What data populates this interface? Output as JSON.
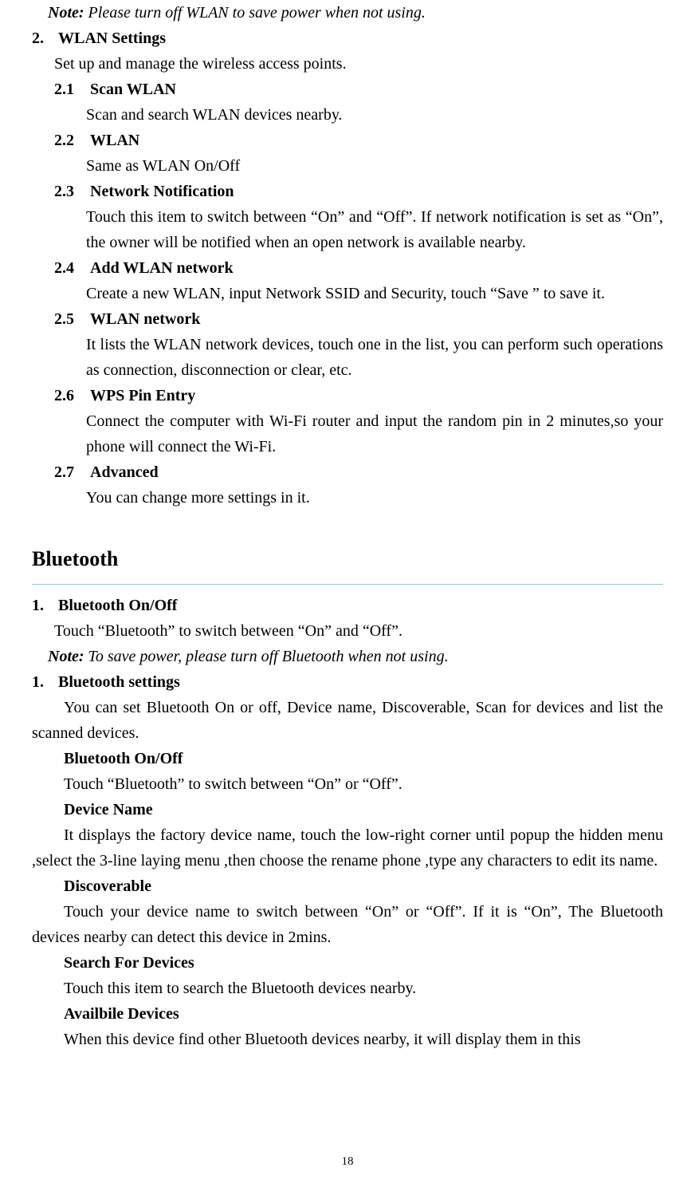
{
  "wlan": {
    "note": {
      "label": "Note:",
      "text": "Please turn off WLAN to save power when not using."
    },
    "item2": {
      "num": "2.",
      "title": "WLAN Settings",
      "body": "Set up and manage the wireless access points.",
      "sub": {
        "s21": {
          "num": "2.1",
          "title": "Scan WLAN",
          "body": "Scan and search WLAN devices nearby."
        },
        "s22": {
          "num": "2.2",
          "title": "WLAN",
          "body": "Same as WLAN On/Off"
        },
        "s23": {
          "num": "2.3",
          "title": "Network Notification",
          "body": "Touch this item to switch between “On” and “Off”. If network notification is set as “On”, the owner will be notified when an open network is available nearby."
        },
        "s24": {
          "num": "2.4",
          "title": "Add WLAN network",
          "body": "Create a new WLAN, input Network SSID and Security, touch “Save ” to save it."
        },
        "s25": {
          "num": "2.5",
          "title": "WLAN network",
          "body": "It lists the WLAN network devices, touch one in the list, you can perform such operations as connection, disconnection or clear, etc."
        },
        "s26": {
          "num": "2.6",
          "title": " WPS Pin Entry",
          "body": "Connect the computer with Wi-Fi router and input the random pin in 2 minutes,so your phone will connect the Wi-Fi."
        },
        "s27": {
          "num": "2.7",
          "title": " Advanced",
          "body": "You can change more settings in it."
        }
      }
    }
  },
  "bluetooth": {
    "heading": "Bluetooth",
    "item1a": {
      "num": "1.",
      "title": "Bluetooth On/Off",
      "body": "Touch “Bluetooth” to switch between “On” and “Off”.",
      "note": {
        "label": "Note:",
        "text": "To save power, please turn off Bluetooth when not using."
      }
    },
    "item1b": {
      "num": "1.",
      "title": "Bluetooth settings",
      "body": "You can set Bluetooth On or off, Device name, Discoverable, Scan for devices and list the scanned devices.",
      "sub": {
        "onoff": {
          "title": "Bluetooth On/Off",
          "body": "Touch “Bluetooth” to switch between “On” or “Off”."
        },
        "devname": {
          "title": "Device Name",
          "body": "It displays the factory device name, touch the low-right corner until popup the hidden menu ,select the 3-line laying menu ,then choose the rename phone ,type any characters to edit its name."
        },
        "discover": {
          "title": "Discoverable",
          "body": "Touch your device name   to switch between “On” or “Off”. If it is “On”, The Bluetooth devices nearby can detect this device in 2mins."
        },
        "search": {
          "title": "Search For Devices",
          "body": "Touch this item to search the Bluetooth devices nearby."
        },
        "avail": {
          "title": "Availbile Devices",
          "body": "When this device find other Bluetooth devices nearby, it will display them in this"
        }
      }
    }
  },
  "page": "18"
}
